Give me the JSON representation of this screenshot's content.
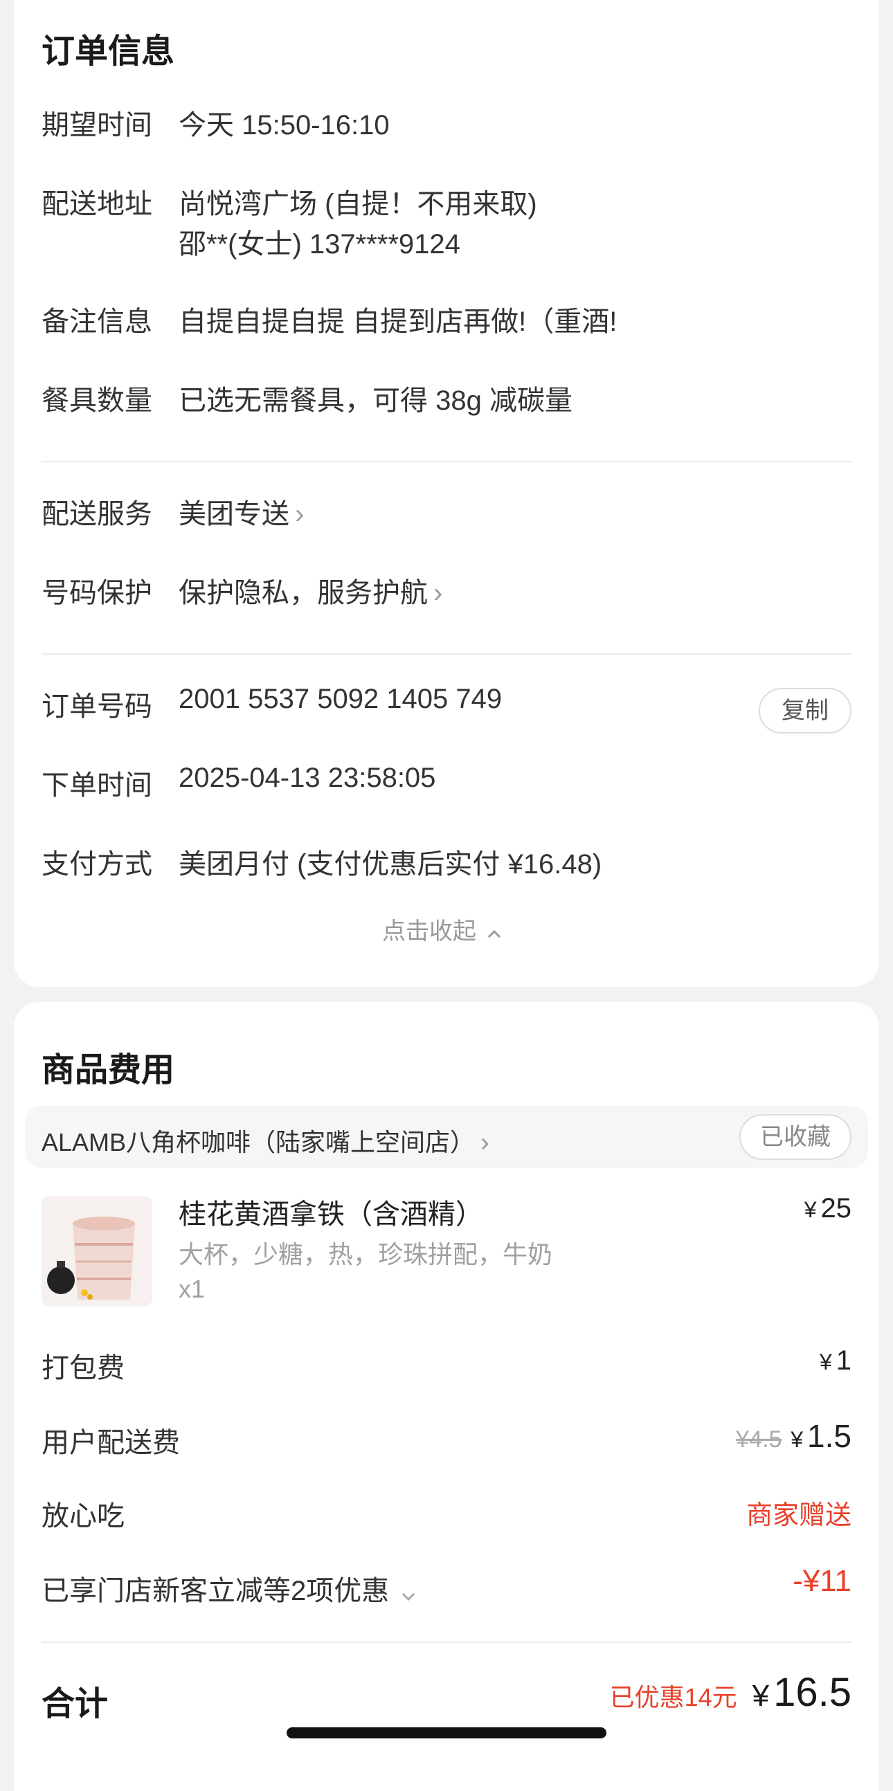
{
  "order_info": {
    "title": "订单信息",
    "rows": [
      {
        "label": "期望时间",
        "value": "今天 15:50-16:10"
      },
      {
        "label": "配送地址",
        "value": "尚悦湾广场 (自提！不用来取)",
        "value2": "邵**(女士) 137****9124"
      },
      {
        "label": "备注信息",
        "value": "自提自提自提 自提到店再做!（重酒!"
      },
      {
        "label": "餐具数量",
        "value": "已选无需餐具，可得 38g 减碳量"
      }
    ],
    "service_rows": [
      {
        "label": "配送服务",
        "value": "美团专送"
      },
      {
        "label": "号码保护",
        "value": "保护隐私，服务护航"
      }
    ],
    "order_rows": [
      {
        "label": "订单号码",
        "value": "2001 5537 5092 1405 749"
      },
      {
        "label": "下单时间",
        "value": "2025-04-13 23:58:05"
      },
      {
        "label": "支付方式",
        "value": "美团月付 (支付优惠后实付 ¥16.48)"
      }
    ],
    "copy_label": "复制",
    "collapse_label": "点击收起"
  },
  "goods": {
    "title": "商品费用",
    "shop_name": "ALAMB八角杯咖啡（陆家嘴上空间店）",
    "saved_label": "已收藏",
    "item": {
      "name": "桂花黄酒拿铁（含酒精）",
      "specs": "大杯，少糖，热，珍珠拼配，牛奶",
      "qty": "x1",
      "currency": "¥",
      "price": "25"
    },
    "fees": [
      {
        "label": "打包费",
        "currency": "¥",
        "value": "1"
      },
      {
        "label": "用户配送费",
        "original": "¥4.5",
        "currency": "¥",
        "value": "1.5"
      },
      {
        "label": "放心吃",
        "value": "商家赠送"
      },
      {
        "label": "已享门店新客立减等2项优惠",
        "value": "-¥11"
      }
    ],
    "total": {
      "label": "合计",
      "saved_text": "已优惠14元",
      "currency": "¥",
      "value": "16.5"
    }
  },
  "colors": {
    "accent_red": "#e8412a",
    "text_primary": "#222222",
    "text_secondary": "#a0a0a0",
    "background": "#f2f2f2"
  }
}
